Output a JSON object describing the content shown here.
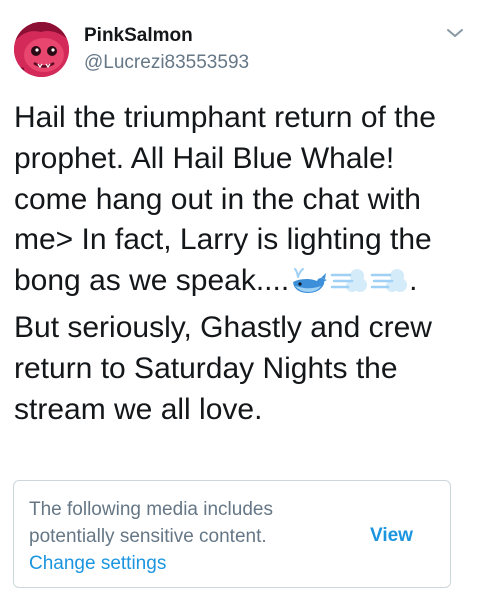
{
  "tweet": {
    "author": {
      "display_name": "PinkSalmon",
      "handle": "@Lucrezi83553593"
    },
    "text_segments": [
      "Hail the triumphant return of the\nprophet. All Hail Blue Whale!\ncome hang out in the chat with\nme> In fact, Larry is lighting the\nbong as we speak....",
      ".\nBut seriously, Ghastly and crew\nreturn to Saturday Nights the\nstream we all love."
    ],
    "emojis": [
      "whale-emoji",
      "dash-emoji",
      "dash-emoji"
    ]
  },
  "sensitive_notice": {
    "line1": "The following media includes",
    "line2": "potentially sensitive content.",
    "change_settings": "Change settings",
    "view": "View"
  },
  "colors": {
    "text": "#14171a",
    "secondary": "#657786",
    "link": "#1b95e0",
    "border": "#ccd6dd"
  }
}
